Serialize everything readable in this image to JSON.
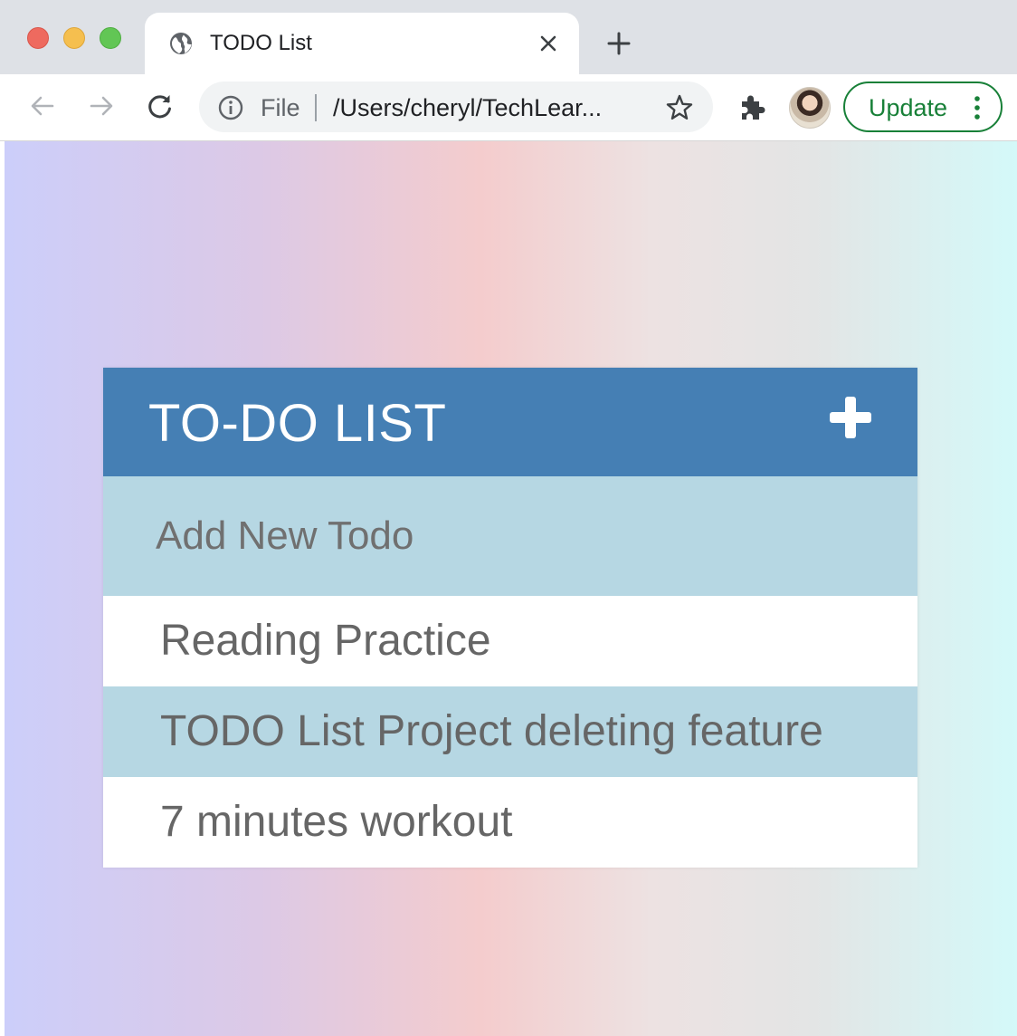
{
  "browser": {
    "tab": {
      "title": "TODO List"
    },
    "address_bar": {
      "scheme_label": "File",
      "url": "/Users/cheryl/TechLear..."
    },
    "update_button": {
      "label": "Update",
      "color": "#188038"
    },
    "traffic_lights": {
      "close": "#ee6a5f",
      "minimize": "#f5bf4f",
      "maximize": "#62c655"
    }
  },
  "app": {
    "title": "TO-DO LIST",
    "header_color": "#457fb4",
    "stripe_color": "#b6d7e3",
    "new_todo": {
      "placeholder": "Add New Todo",
      "value": ""
    },
    "todos": [
      {
        "text": "Reading Practice"
      },
      {
        "text": "TODO List Project deleting feature"
      },
      {
        "text": "7 minutes workout"
      }
    ]
  }
}
